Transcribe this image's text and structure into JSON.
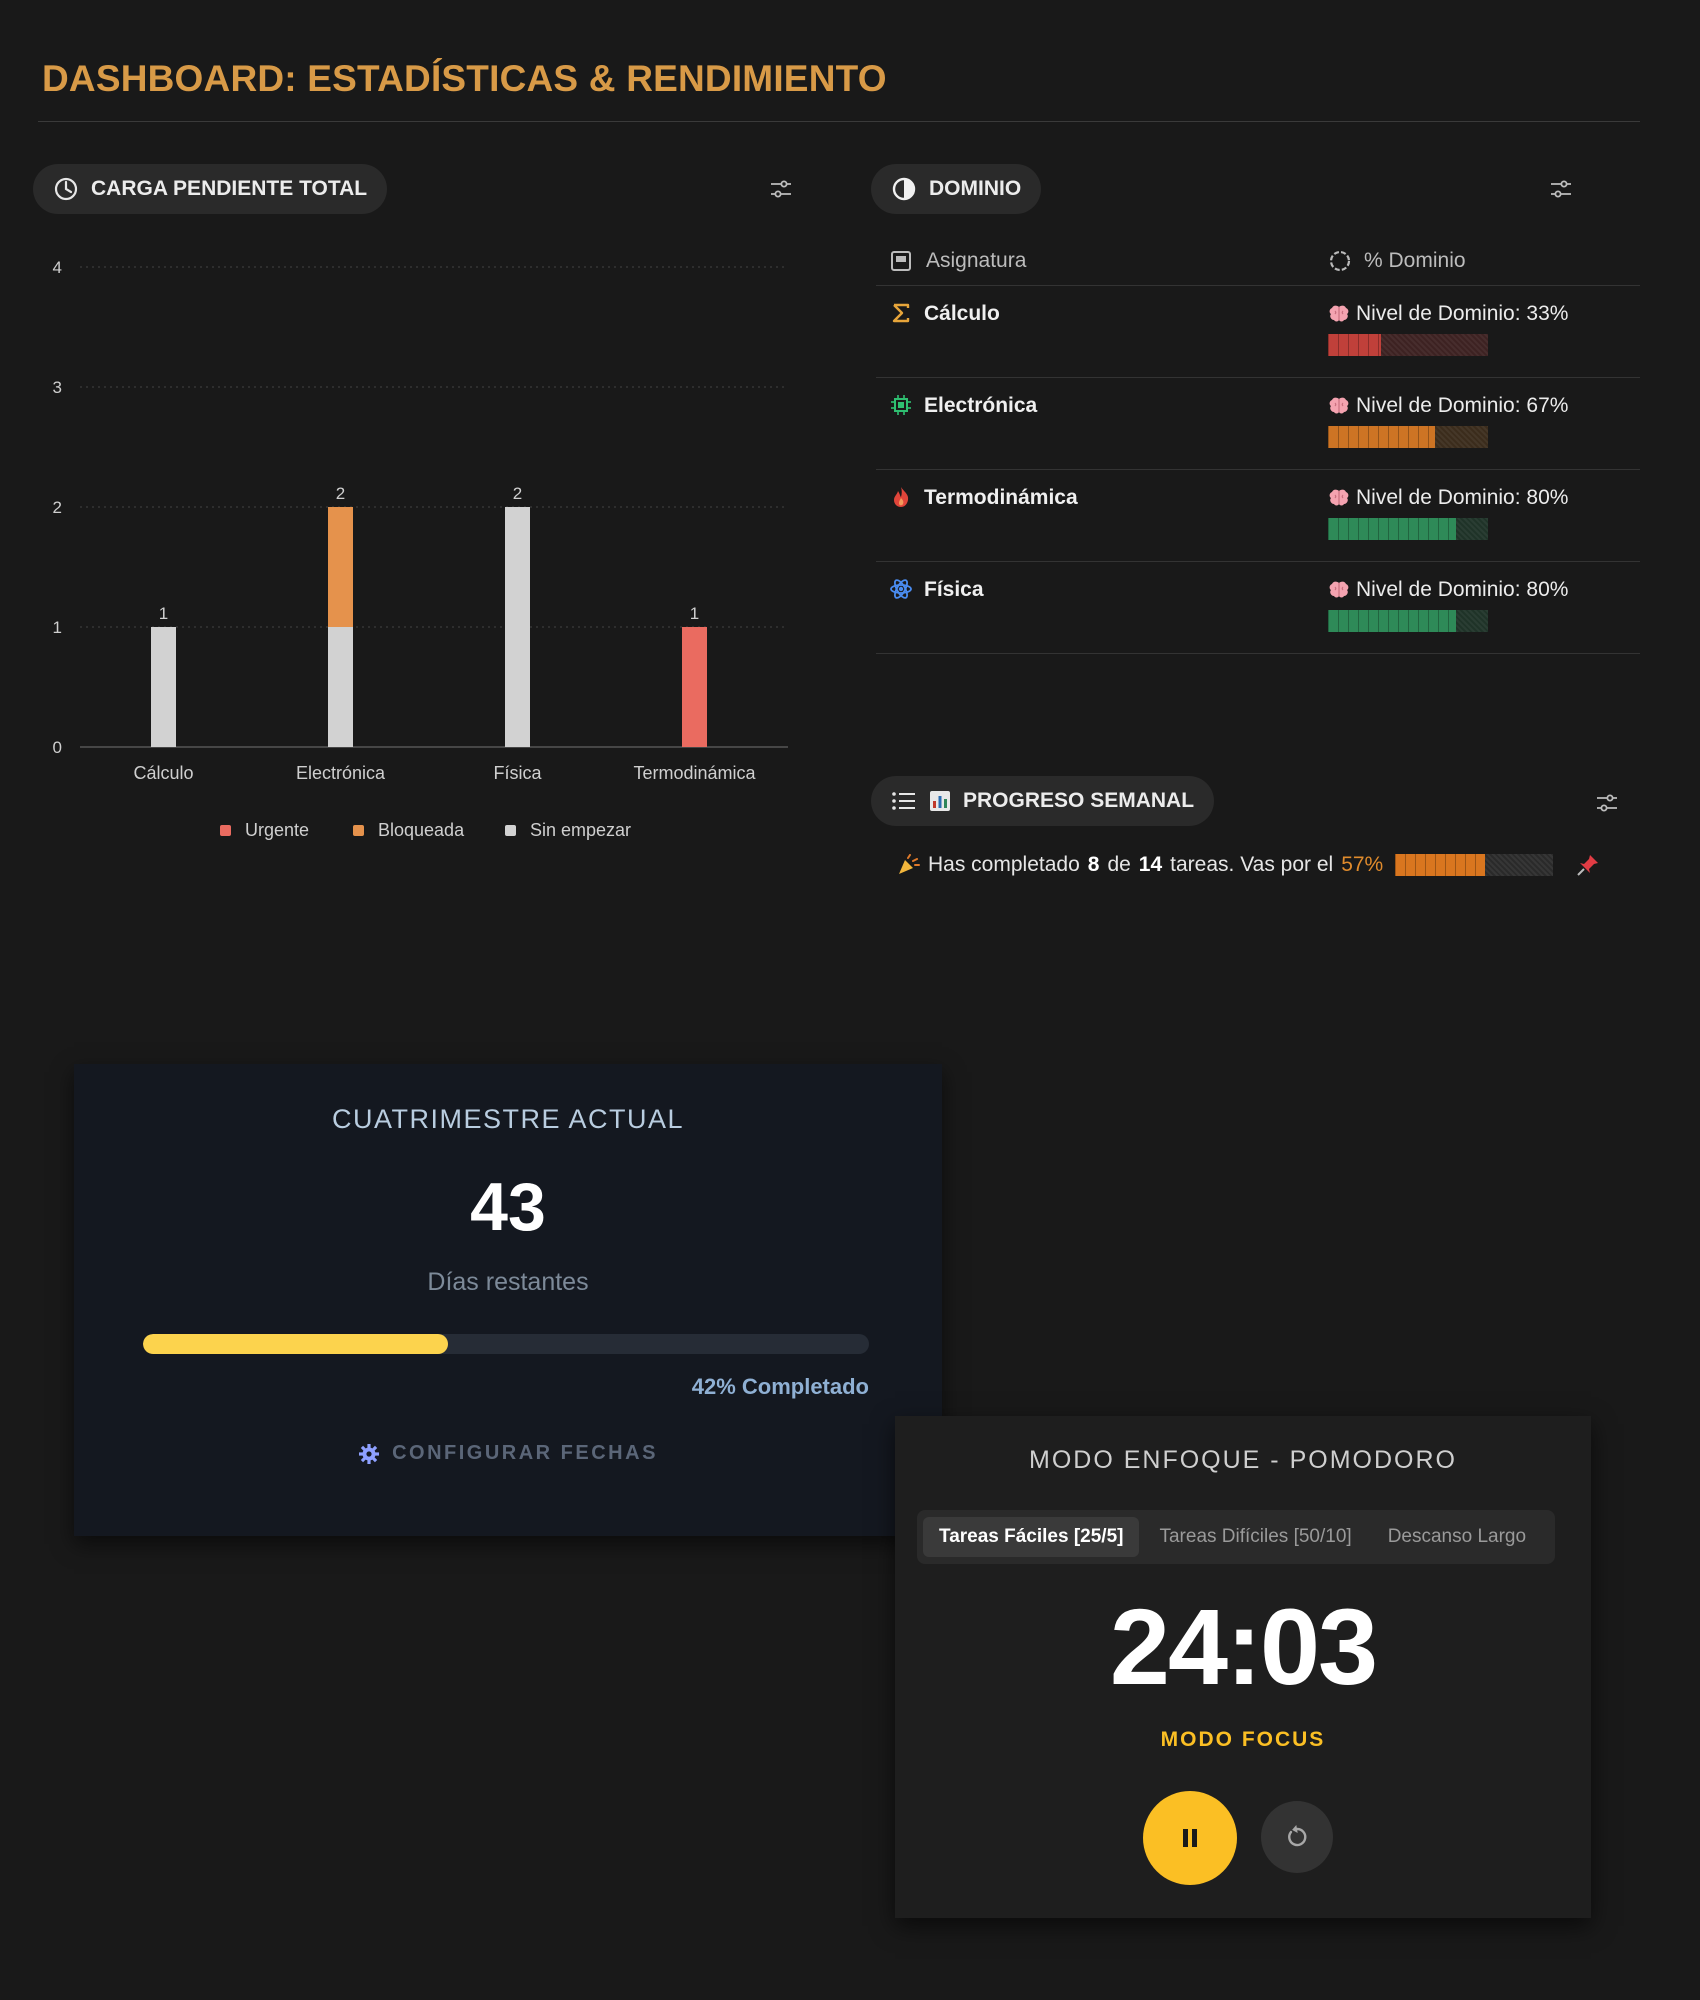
{
  "page_title": "DASHBOARD: ESTADÍSTICAS & RENDIMIENTO",
  "carga": {
    "label": "CARGA PENDIENTE TOTAL",
    "legend": [
      "Urgente",
      "Bloqueada",
      "Sin empezar"
    ]
  },
  "chart_data": {
    "type": "bar",
    "stacked": true,
    "categories": [
      "Cálculo",
      "Electrónica",
      "Física",
      "Termodinámica"
    ],
    "series": [
      {
        "name": "Urgente",
        "color": "#ea6b60",
        "values": [
          0,
          0,
          0,
          1
        ]
      },
      {
        "name": "Bloqueada",
        "color": "#e5924c",
        "values": [
          0,
          1,
          0,
          0
        ]
      },
      {
        "name": "Sin empezar",
        "color": "#d2d2d2",
        "values": [
          1,
          1,
          2,
          0
        ]
      }
    ],
    "totals": [
      1,
      2,
      2,
      1
    ],
    "ylim": [
      0,
      4
    ],
    "yticks": [
      0,
      1,
      2,
      3,
      4
    ],
    "grid": true,
    "legend_position": "bottom"
  },
  "dominio": {
    "label": "DOMINIO",
    "col_subject": "Asignatura",
    "col_pct": "% Dominio",
    "rows": [
      {
        "subject": "Cálculo",
        "icon": "sigma-icon",
        "level": "Nivel de Dominio: 33%",
        "pct": 33,
        "color": "#c0403a",
        "empty": "#3d2222"
      },
      {
        "subject": "Electrónica",
        "icon": "chip-icon",
        "level": "Nivel de Dominio: 67%",
        "pct": 67,
        "color": "#cd7424",
        "empty": "#3b2c1c"
      },
      {
        "subject": "Termodinámica",
        "icon": "fire-icon",
        "level": "Nivel de Dominio: 80%",
        "pct": 80,
        "color": "#2e8a58",
        "empty": "#1f3328"
      },
      {
        "subject": "Física",
        "icon": "atom-icon",
        "level": "Nivel de Dominio: 80%",
        "pct": 80,
        "color": "#2e8a58",
        "empty": "#1f3328"
      }
    ]
  },
  "progreso": {
    "label": "PROGRESO SEMANAL",
    "text_pre": "Has completado",
    "done": "8",
    "text_mid": "de",
    "total": "14",
    "text_post": "tareas. Vas por el",
    "pct_text": "57%",
    "pct": 57,
    "bar_color": "#d9761f"
  },
  "semestre": {
    "title": "CUATRIMESTRE ACTUAL",
    "days": "43",
    "days_label": "Días restantes",
    "progress": 42,
    "progress_text": "42% Completado",
    "config_label": "CONFIGURAR FECHAS"
  },
  "pomodoro": {
    "title": "MODO ENFOQUE - POMODORO",
    "tabs": [
      "Tareas Fáciles [25/5]",
      "Tareas Difíciles [50/10]",
      "Descanso Largo"
    ],
    "active_tab": 0,
    "time": "24:03",
    "mode": "MODO FOCUS"
  }
}
